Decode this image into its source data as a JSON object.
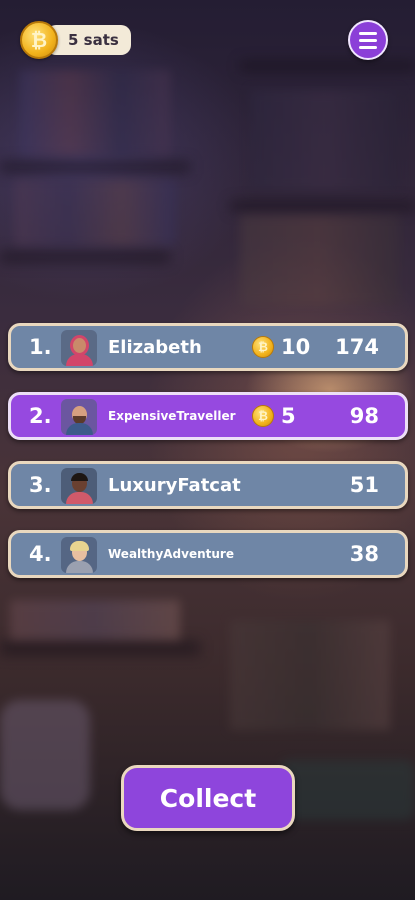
{
  "wallet": {
    "sats_label": "5 sats",
    "coin_symbol": "₿"
  },
  "menu": {
    "icon": "hamburger-menu-icon"
  },
  "leaderboard": [
    {
      "rank": "1.",
      "name": "Elizabeth",
      "coins": "10",
      "score": "174",
      "highlight": false,
      "avatar": "avatar-woman-hijab"
    },
    {
      "rank": "2.",
      "name": "ExpensiveTraveller",
      "coins": "5",
      "score": "98",
      "highlight": true,
      "avatar": "avatar-man-beard"
    },
    {
      "rank": "3.",
      "name": "LuxuryFatcat",
      "coins": null,
      "score": "51",
      "highlight": false,
      "avatar": "avatar-man-dark"
    },
    {
      "rank": "4.",
      "name": "WealthyAdventure",
      "coins": null,
      "score": "38",
      "highlight": false,
      "avatar": "avatar-woman-blonde"
    }
  ],
  "actions": {
    "collect_label": "Collect"
  },
  "colors": {
    "row": "#6f86a6",
    "row_highlight": "#9649e0",
    "button": "#8e45dc",
    "border": "#e9d8bf",
    "coin": "#f2b21b"
  }
}
